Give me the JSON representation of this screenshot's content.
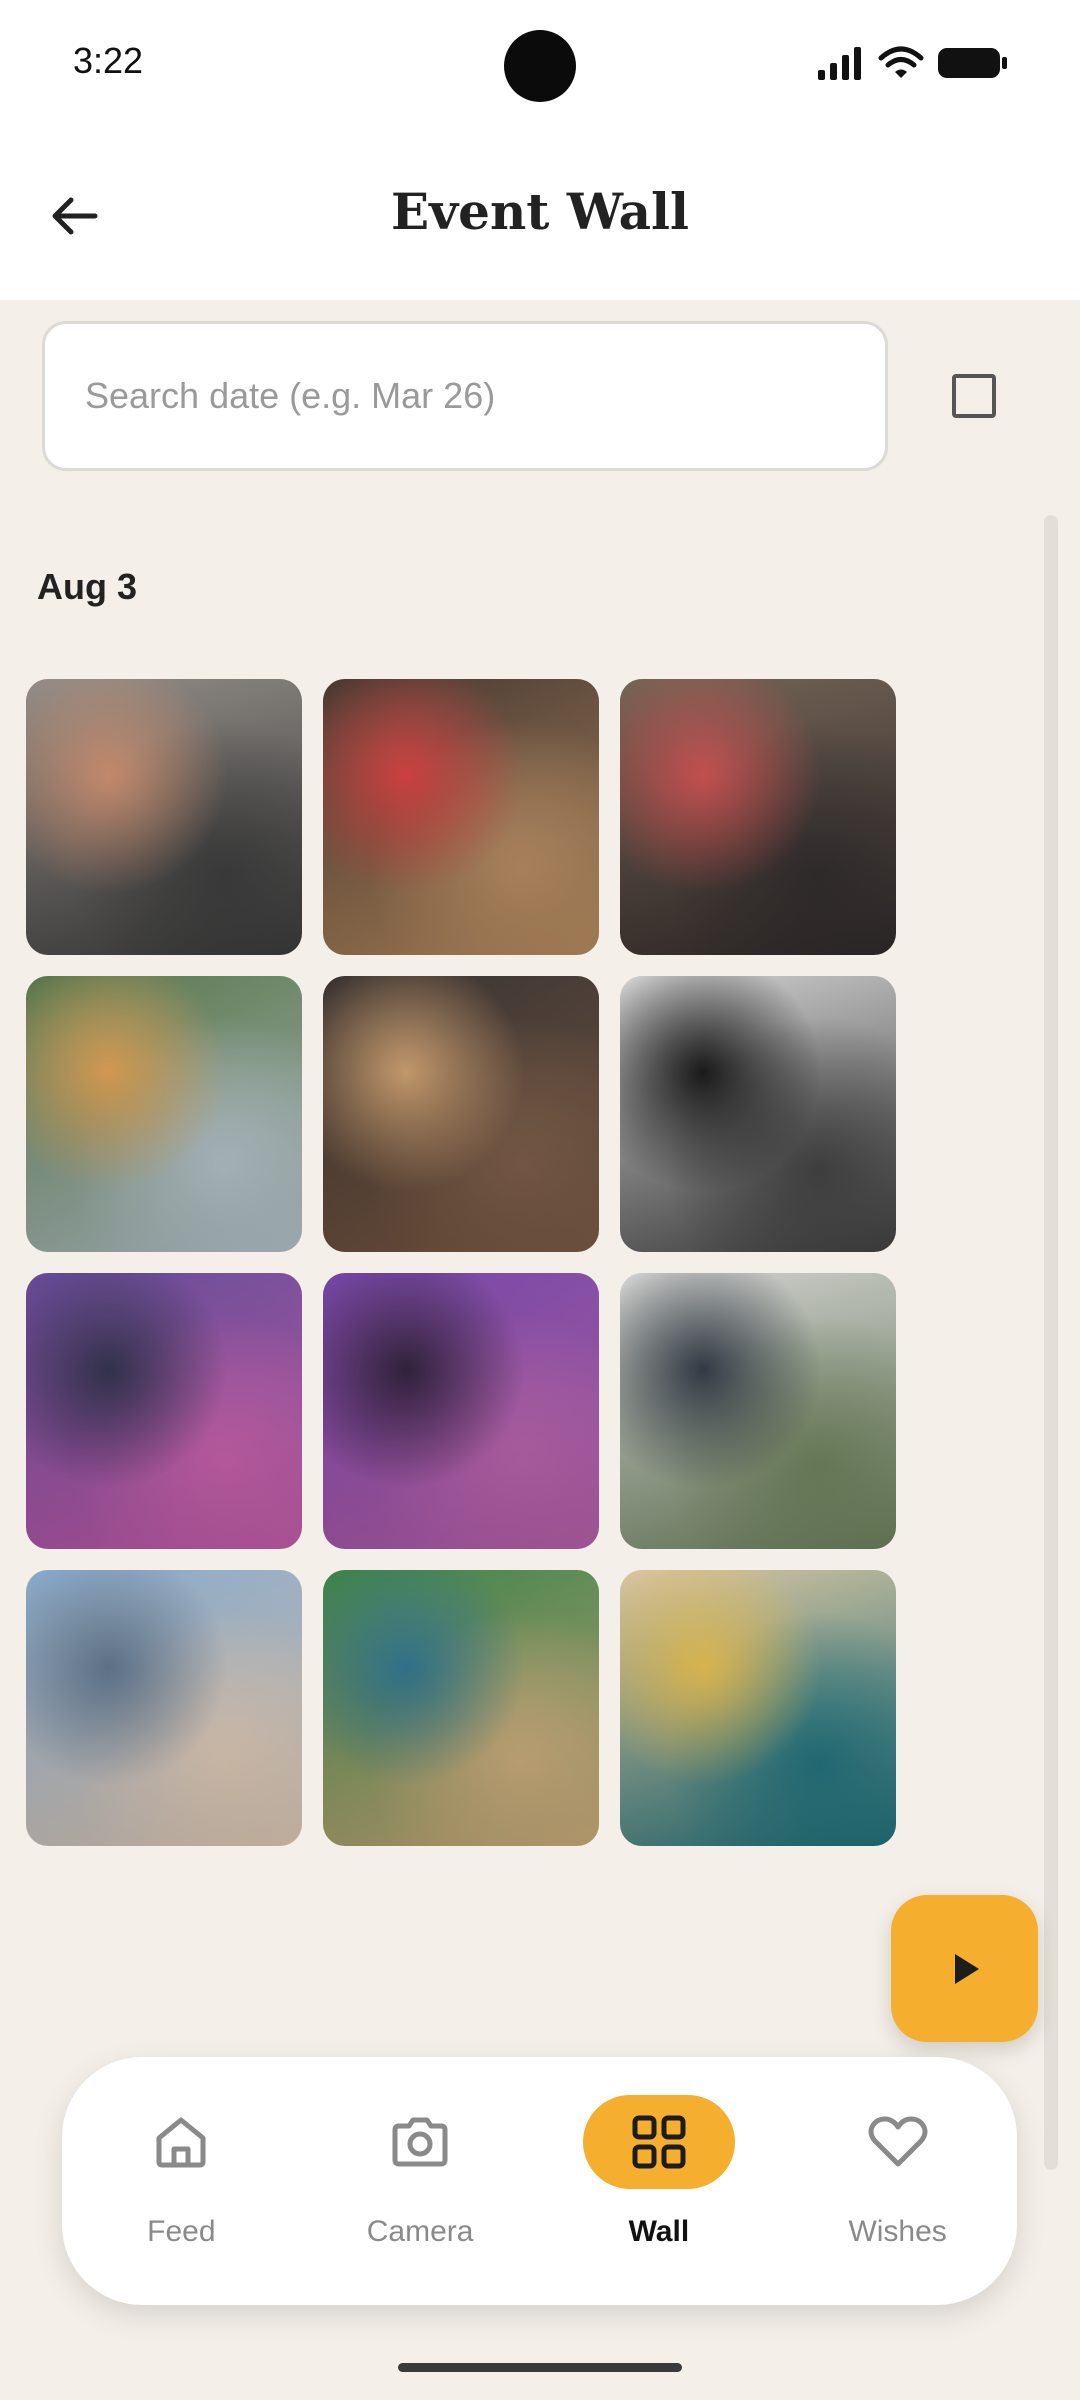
{
  "status_bar": {
    "time": "3:22",
    "icons": [
      "signal-icon",
      "wifi-icon",
      "battery-icon"
    ]
  },
  "header": {
    "title": "Event Wall",
    "back_icon": "arrow-left-icon"
  },
  "search": {
    "placeholder": "Search date (e.g. Mar 26)",
    "value": ""
  },
  "selection": {
    "checkbox_checked": false
  },
  "wall": {
    "date": "Aug 3",
    "photos": [
      {
        "desc": "scrapbook-flatlay",
        "colors": [
          "#8c8680",
          "#3a3a3a",
          "#c98a6a"
        ]
      },
      {
        "desc": "graduate-photo",
        "colors": [
          "#3a2b24",
          "#b58a5f",
          "#d23b3b"
        ]
      },
      {
        "desc": "street-crowd",
        "colors": [
          "#6d5a4a",
          "#2f2a2a",
          "#c94b4b"
        ]
      },
      {
        "desc": "outdoor-festival",
        "colors": [
          "#4d6d3d",
          "#b0bec5",
          "#d99a4b"
        ]
      },
      {
        "desc": "couple-dancing",
        "colors": [
          "#2a2422",
          "#7a5a44",
          "#c89a6a"
        ]
      },
      {
        "desc": "bw-friends",
        "colors": [
          "#d0d0d0",
          "#404040",
          "#111111"
        ]
      },
      {
        "desc": "concert-crowd",
        "colors": [
          "#5a3f91",
          "#c25ca6",
          "#2b2b48"
        ]
      },
      {
        "desc": "phones-concert",
        "colors": [
          "#6b3aa0",
          "#b35fa6",
          "#2a1a36"
        ]
      },
      {
        "desc": "woman-flowers",
        "colors": [
          "#cfcfcf",
          "#6b7f5b",
          "#2d3440"
        ]
      },
      {
        "desc": "champagne-toast",
        "colors": [
          "#7fa3c7",
          "#d9c4b0",
          "#5a6f86"
        ]
      },
      {
        "desc": "green-dancers",
        "colors": [
          "#2f7a3d",
          "#c8a878",
          "#2a6f8a"
        ]
      },
      {
        "desc": "teal-celebration",
        "colors": [
          "#d8c29a",
          "#1f6f7a",
          "#e0b84a"
        ]
      }
    ]
  },
  "play_button": {
    "icon": "play-icon"
  },
  "nav": {
    "items": [
      {
        "label": "Feed",
        "icon": "home-icon",
        "active": false
      },
      {
        "label": "Camera",
        "icon": "camera-icon",
        "active": false
      },
      {
        "label": "Wall",
        "icon": "grid-icon",
        "active": true
      },
      {
        "label": "Wishes",
        "icon": "heart-icon",
        "active": false
      }
    ]
  },
  "colors": {
    "accent": "#f5ae2d",
    "background": "#f4efe8"
  }
}
